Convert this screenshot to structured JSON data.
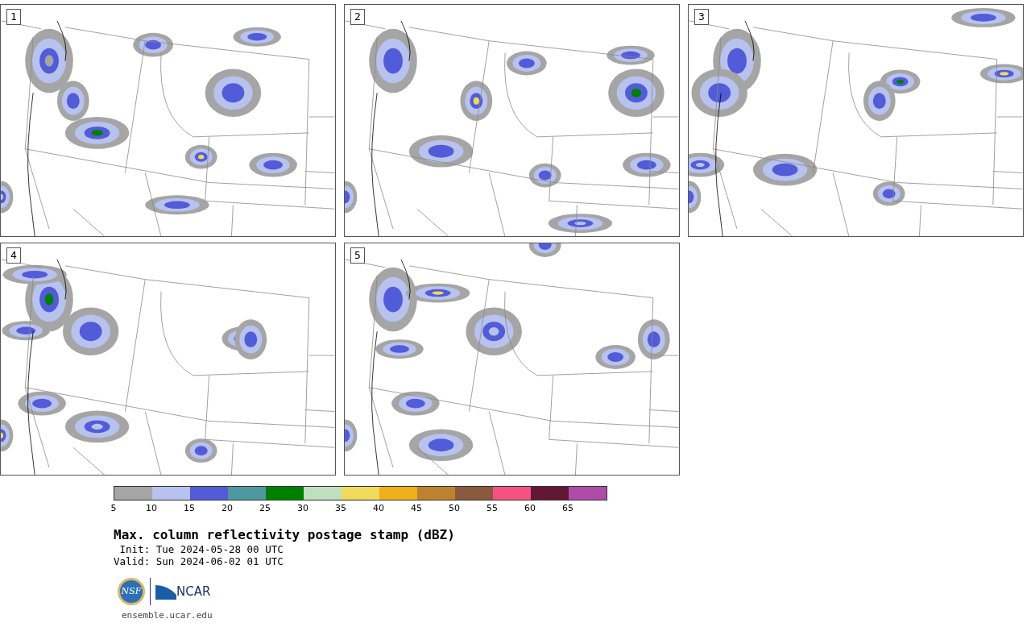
{
  "panels": [
    {
      "label": "1"
    },
    {
      "label": "2"
    },
    {
      "label": "3"
    },
    {
      "label": "4"
    },
    {
      "label": "5"
    }
  ],
  "colorbar": {
    "segments": [
      {
        "label": "5",
        "color": "#a5a5a5"
      },
      {
        "label": "10",
        "color": "#b8c2ee"
      },
      {
        "label": "15",
        "color": "#525bd8"
      },
      {
        "label": "20",
        "color": "#4e989f"
      },
      {
        "label": "25",
        "color": "#008000"
      },
      {
        "label": "30",
        "color": "#c0dfbe"
      },
      {
        "label": "35",
        "color": "#f0da5c"
      },
      {
        "label": "40",
        "color": "#efae1a"
      },
      {
        "label": "45",
        "color": "#bd8230"
      },
      {
        "label": "50",
        "color": "#8a5a3e"
      },
      {
        "label": "55",
        "color": "#f55281"
      },
      {
        "label": "60",
        "color": "#621734"
      },
      {
        "label": "65",
        "color": "#ae4da8"
      }
    ]
  },
  "title": "Max. column reflectivity postage stamp (dBZ)",
  "init": " Init: Tue 2024-05-28 00 UTC",
  "valid": "Valid: Sun 2024-06-02 01 UTC",
  "logo": {
    "nsf": "NSF",
    "ncar": "NCAR"
  },
  "url": "ensemble.ucar.edu"
}
